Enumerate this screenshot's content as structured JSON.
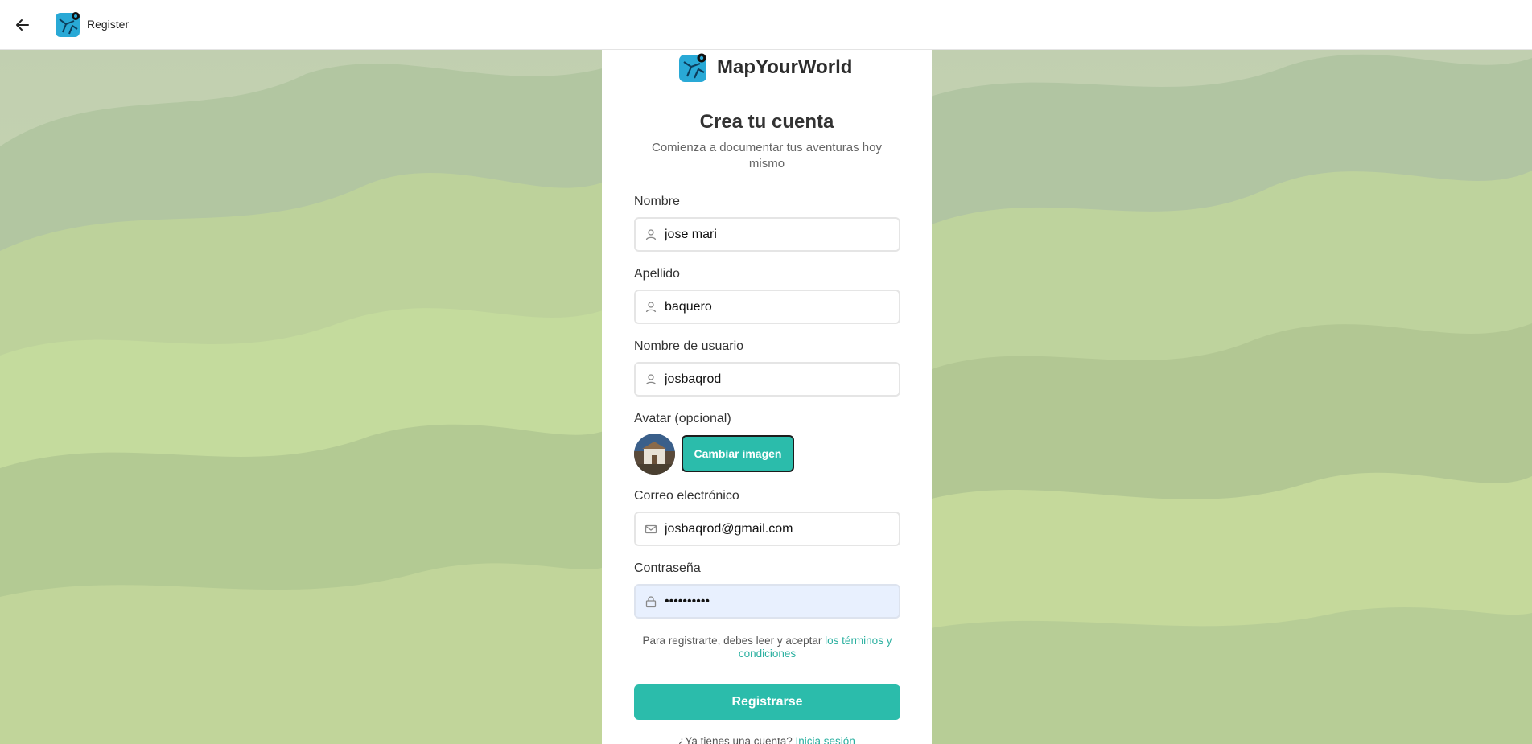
{
  "topbar": {
    "title": "Register",
    "back_icon": "arrow-left-icon"
  },
  "brand": {
    "name": "MapYourWorld"
  },
  "heading": {
    "title": "Crea tu cuenta",
    "subtitle": "Comienza a documentar tus aventuras hoy mismo"
  },
  "form": {
    "nombre": {
      "label": "Nombre",
      "value": "jose mari",
      "icon": "user-icon"
    },
    "apellido": {
      "label": "Apellido",
      "value": "baquero",
      "icon": "user-icon"
    },
    "usuario": {
      "label": "Nombre de usuario",
      "value": "josbaqrod",
      "icon": "user-icon"
    },
    "avatar": {
      "label": "Avatar (opcional)",
      "button": "Cambiar imagen"
    },
    "email": {
      "label": "Correo electrónico",
      "value": "josbaqrod@gmail.com",
      "icon": "mail-icon"
    },
    "password": {
      "label": "Contraseña",
      "value": "••••••••••",
      "icon": "lock-icon"
    }
  },
  "terms": {
    "text": "Para registrarte, debes leer y aceptar ",
    "link": "los términos y condiciones"
  },
  "submit_label": "Registrarse",
  "login": {
    "text": "¿Ya tienes una cuenta? ",
    "link": "Inicia sesión"
  },
  "colors": {
    "accent": "#2bbcab",
    "link": "#2bb0a0",
    "autofill": "#e8f0fe"
  }
}
